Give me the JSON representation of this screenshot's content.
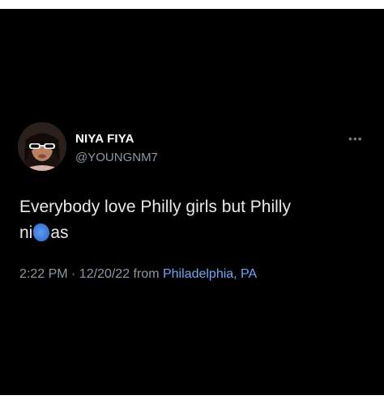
{
  "tweet": {
    "display_name": "NIYA FIYA",
    "handle": "@YOUNGNM7",
    "more_label": "•••",
    "text_part1": "Everybody love Philly girls but Philly",
    "text_part2a": "ni",
    "text_part2b": "as",
    "timestamp": "2:22 PM · 12/20/22 from",
    "location": "Philadelphia, PA"
  },
  "colors": {
    "background": "#000000",
    "primary_text": "#e7e9ea",
    "secondary_text": "#8b98a5",
    "link": "#6ea8f7",
    "censor_blob": "#3f7fdc"
  },
  "icons": {
    "more": "more-horizontal-icon",
    "censor": "emoji-scribble-icon"
  }
}
